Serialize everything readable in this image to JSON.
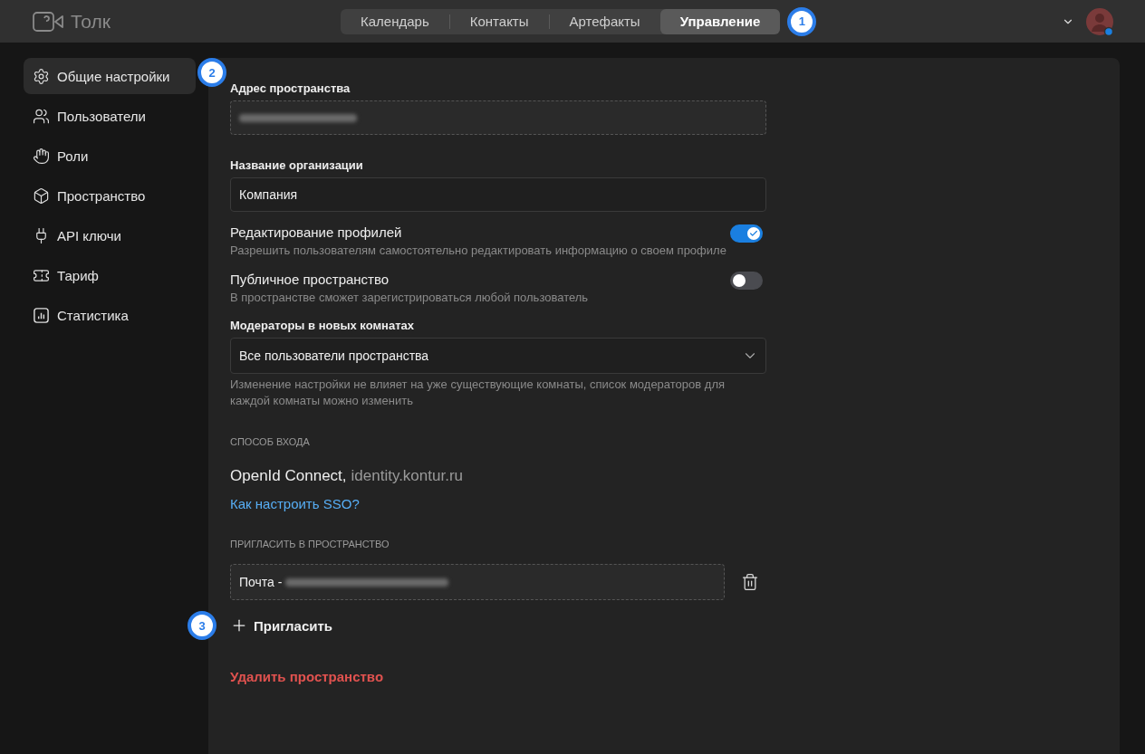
{
  "app": {
    "name": "Толк"
  },
  "nav_tabs": [
    {
      "label": "Календарь",
      "selected": false
    },
    {
      "label": "Контакты",
      "selected": false
    },
    {
      "label": "Артефакты",
      "selected": false
    },
    {
      "label": "Управление",
      "selected": true
    }
  ],
  "callouts": [
    "1",
    "2",
    "3"
  ],
  "user": {
    "online": true
  },
  "sidebar": {
    "items": [
      {
        "label": "Общие настройки",
        "kind": "settings",
        "selected": true
      },
      {
        "label": "Пользователи",
        "kind": "users",
        "selected": false
      },
      {
        "label": "Роли",
        "kind": "roles",
        "selected": false
      },
      {
        "label": "Пространство",
        "kind": "space",
        "selected": false
      },
      {
        "label": "API ключи",
        "kind": "api",
        "selected": false
      },
      {
        "label": "Тариф",
        "kind": "tariff",
        "selected": false
      },
      {
        "label": "Статистика",
        "kind": "stats",
        "selected": false
      }
    ]
  },
  "settings": {
    "address": {
      "label": "Адрес пространства"
    },
    "org_name": {
      "label": "Название организации",
      "value": "Компания"
    },
    "toggles": [
      {
        "title": "Редактирование профилей",
        "description": "Разрешить пользователям самостоятельно редактировать информацию о своем профиле",
        "on": true
      },
      {
        "title": "Публичное пространство",
        "description": "В пространстве сможет зарегистрироваться любой пользователь",
        "on": false
      }
    ],
    "moderators": {
      "label": "Модераторы в новых комнатах",
      "value": "Все пользователи пространства",
      "hint": "Изменение настройки не влияет на уже существующие комнаты, список модераторов для каждой комнаты можно изменить"
    },
    "login": {
      "heading": "СПОСОБ ВХОДА",
      "provider": "OpenId Connect,",
      "domain": "identity.kontur.ru",
      "help_link": "Как настроить SSO?"
    },
    "invite": {
      "heading": "ПРИГЛАСИТЬ В ПРОСТРАНСТВО",
      "entries": [
        {
          "prefix": "Почта -"
        }
      ],
      "add_button": "Пригласить"
    },
    "delete_button": "Удалить пространство"
  }
}
